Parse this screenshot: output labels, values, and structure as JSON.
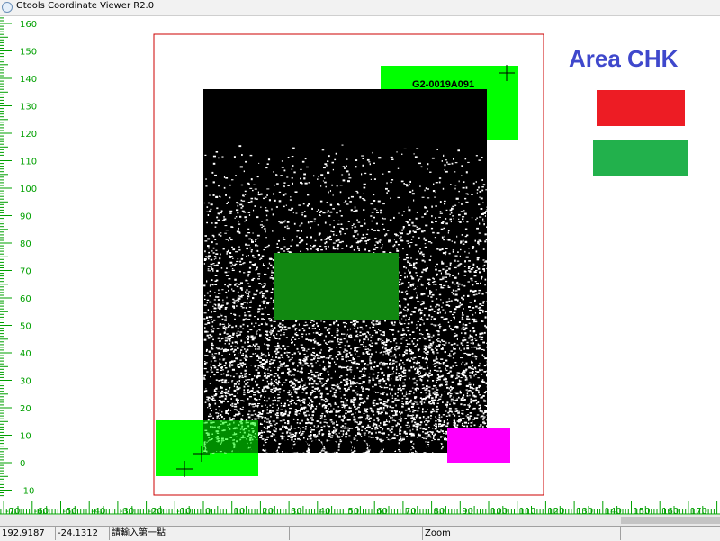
{
  "window": {
    "title": "Gtools Coordinate Viewer R2.0",
    "icon": "app-logo-icon"
  },
  "viewer": {
    "y_ticks": [
      160,
      150,
      140,
      130,
      120,
      110,
      100,
      90,
      80,
      70,
      60,
      50,
      40,
      30,
      20,
      10,
      0,
      -10
    ],
    "x_ticks": [
      -70,
      -60,
      -50,
      -40,
      -30,
      -20,
      -10,
      0,
      10,
      20,
      30,
      40,
      50,
      60,
      70,
      80,
      90,
      100,
      110,
      120,
      130,
      140,
      150,
      160,
      170
    ],
    "part_label": "G2-0019A091",
    "colors": {
      "ruler": "#00a000",
      "boundary": "#cc0000",
      "green_region": "#00ff00",
      "dark_green": "#118811",
      "magenta": "#ff00ff",
      "die": "#000000"
    }
  },
  "legend": {
    "title": "Area CHK",
    "swatches": [
      {
        "name": "red-swatch",
        "color": "#ed1c24"
      },
      {
        "name": "green-swatch",
        "color": "#22b14c"
      }
    ]
  },
  "status": {
    "x_value": "192.9187",
    "y_value": "-24.1312",
    "prompt": "請輸入第一點",
    "empty": "",
    "mode": "Zoom"
  }
}
